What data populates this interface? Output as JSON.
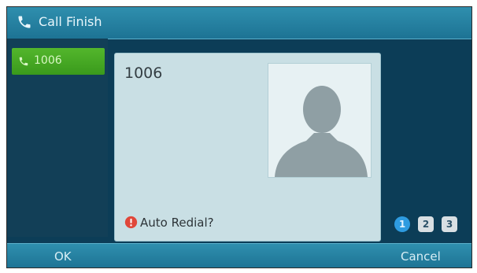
{
  "titlebar": {
    "title": "Call Finish",
    "icon": "phone-handset-icon"
  },
  "sidebar": {
    "line_key_label": "1006",
    "line_key_icon": "phone-handset-icon",
    "accent": "#4aab25"
  },
  "card": {
    "number": "1006",
    "avatar": "person-silhouette-icon",
    "prompt": "Auto Redial?",
    "prompt_icon": "alert-circle-icon",
    "prompt_icon_color": "#e0473a"
  },
  "pager": {
    "pages": [
      "1",
      "2",
      "3"
    ],
    "active_index": 0
  },
  "softkeys": {
    "ok_label": "OK",
    "cancel_label": "Cancel"
  },
  "colors": {
    "background": "#0c3d57",
    "bar": "#1d7394",
    "card": "#c9dfe4"
  }
}
